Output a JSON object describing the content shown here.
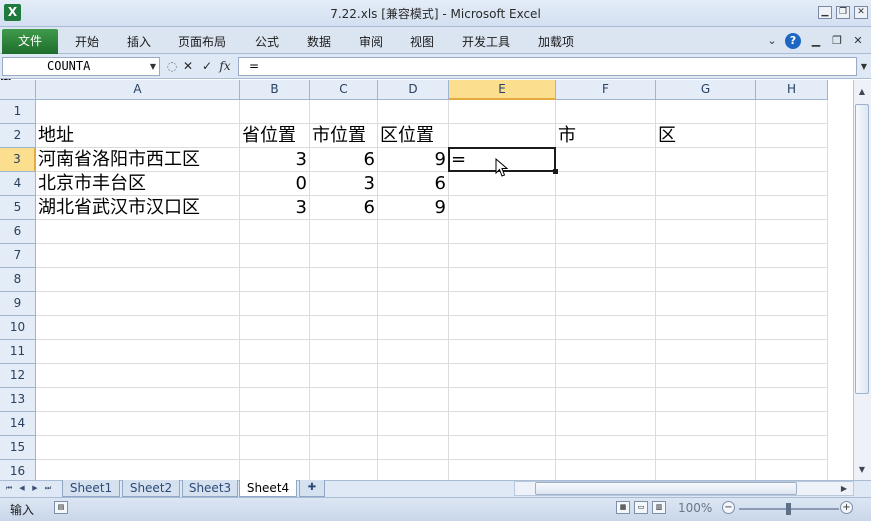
{
  "window": {
    "title": "7.22.xls  [兼容模式] - Microsoft Excel",
    "app_icon_letter": "X"
  },
  "quick_access": {
    "icons": [
      "save-icon",
      "undo-icon",
      "redo-icon",
      "customize-icon"
    ]
  },
  "ribbon": {
    "file_tab": "文件",
    "tabs": [
      "开始",
      "插入",
      "页面布局",
      "公式",
      "数据",
      "审阅",
      "视图",
      "开发工具",
      "加载项"
    ]
  },
  "formula_bar": {
    "name_box": "COUNTA",
    "cancel_glyph": "✕",
    "enter_glyph": "✓",
    "fx_label": "fx",
    "content": "="
  },
  "columns": [
    {
      "letter": "A"
    },
    {
      "letter": "B"
    },
    {
      "letter": "C"
    },
    {
      "letter": "D"
    },
    {
      "letter": "E",
      "selected": true
    },
    {
      "letter": "F"
    },
    {
      "letter": "G"
    },
    {
      "letter": "H"
    }
  ],
  "rows": [
    "1",
    "2",
    "3",
    "4",
    "5",
    "6",
    "7",
    "8",
    "9",
    "10",
    "11",
    "12",
    "13",
    "14",
    "15",
    "16"
  ],
  "selected_row": "3",
  "active_cell": {
    "ref": "E3",
    "value": "="
  },
  "cells": {
    "A2": "地址",
    "B2": "省位置",
    "C2": "市位置",
    "D2": "区位置",
    "F2": "市",
    "G2": "区",
    "A3": "河南省洛阳市西工区",
    "B3": "3",
    "C3": "6",
    "D3": "9",
    "E3": "=",
    "A4": "北京市丰台区",
    "B4": "0",
    "C4": "3",
    "D4": "6",
    "A5": "湖北省武汉市汉口区",
    "B5": "3",
    "C5": "6",
    "D5": "9"
  },
  "sheets": [
    {
      "name": "Sheet1"
    },
    {
      "name": "Sheet2"
    },
    {
      "name": "Sheet3"
    },
    {
      "name": "Sheet4",
      "active": true
    }
  ],
  "status_bar": {
    "mode": "输入",
    "zoom": "100%",
    "zoom_out": "−",
    "zoom_in": "+"
  }
}
